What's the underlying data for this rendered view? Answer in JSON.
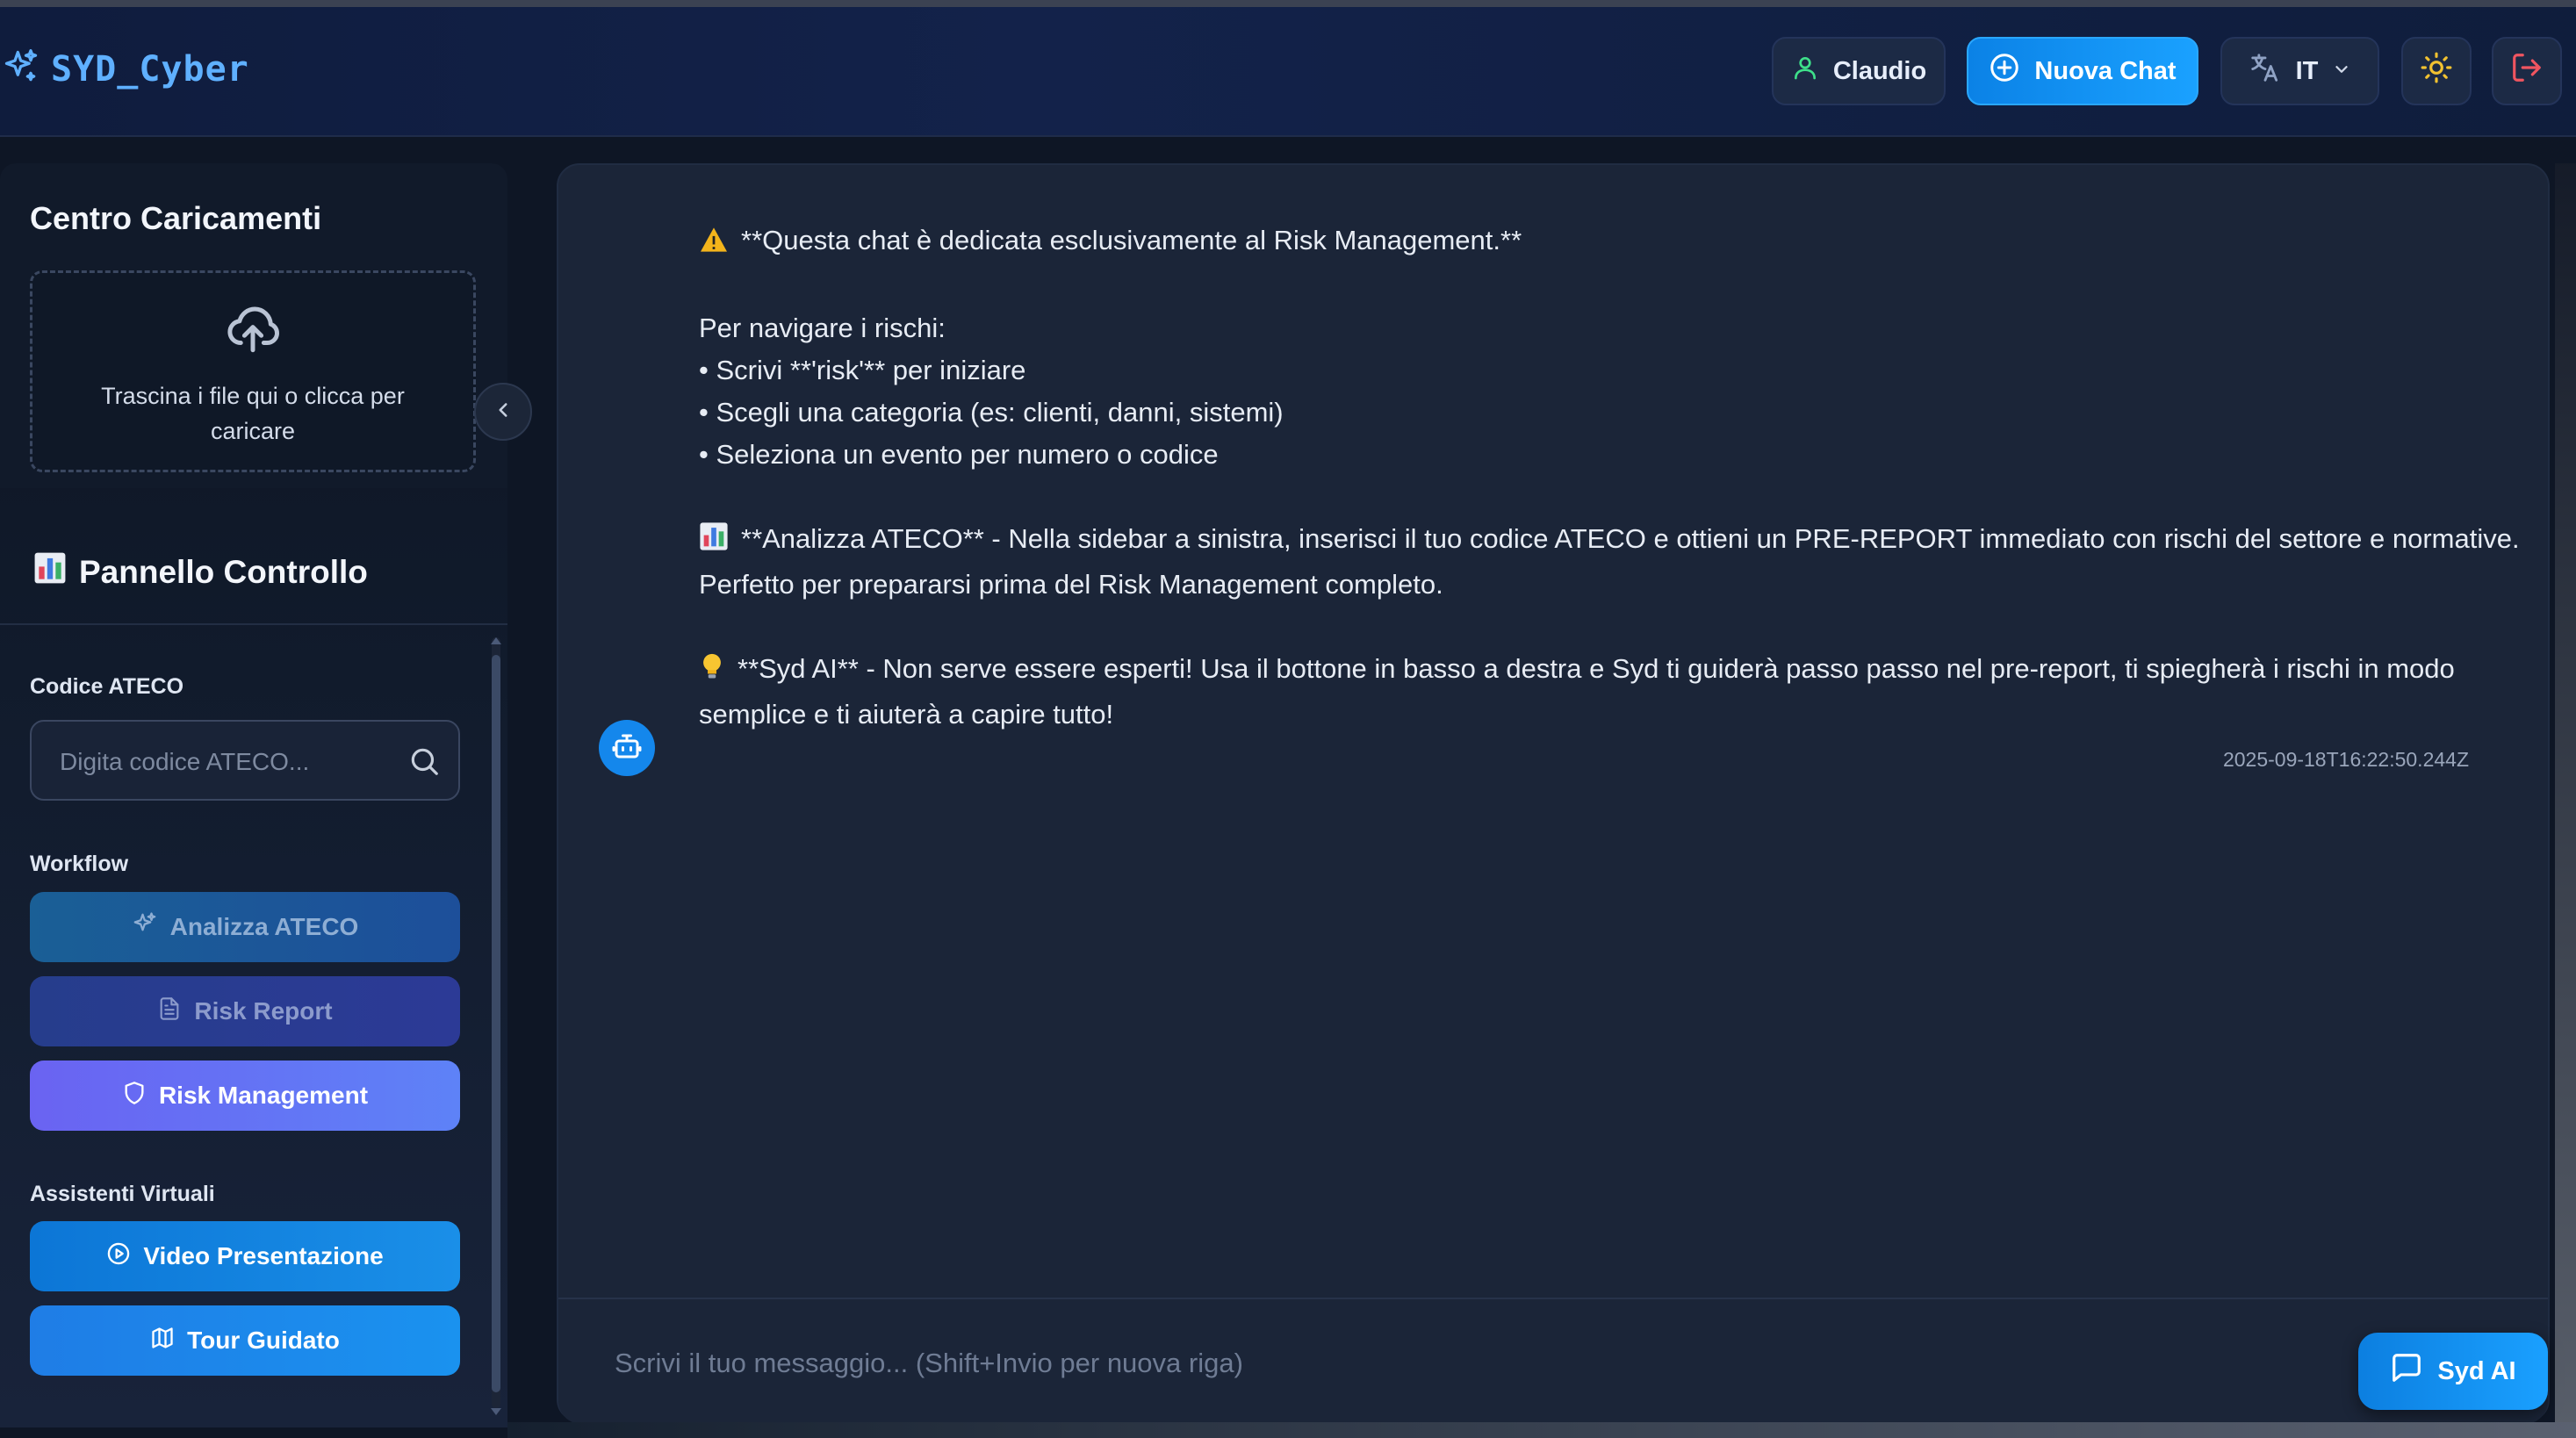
{
  "brand": {
    "name": "SYD_Cyber",
    "icon": "sparkle-icon",
    "color": "#5fb0ff"
  },
  "header": {
    "user_label": "Claudio",
    "new_chat_label": "Nuova Chat",
    "language_label": "IT",
    "icons": [
      "user-icon",
      "plus-circle-icon",
      "translate-icon",
      "chevron-down-icon",
      "sun-icon",
      "logout-icon"
    ]
  },
  "upload": {
    "title": "Centro Caricamenti",
    "dropzone_text": "Trascina i file qui o clicca per caricare",
    "icon": "cloud-upload-icon"
  },
  "control_panel": {
    "title": "Pannello Controllo",
    "ateco_label": "Codice ATECO",
    "ateco_placeholder": "Digita codice ATECO...",
    "ateco_value": "",
    "workflow_label": "Workflow",
    "workflow_buttons": [
      {
        "label": "Analizza ATECO",
        "icon": "sparkle-icon"
      },
      {
        "label": "Risk Report",
        "icon": "document-icon"
      },
      {
        "label": "Risk Management",
        "icon": "shield-icon"
      }
    ],
    "assistants_label": "Assistenti Virtuali",
    "assistant_buttons": [
      {
        "label": "Video Presentazione",
        "icon": "play-circle-icon"
      },
      {
        "label": "Tour Guidato",
        "icon": "map-icon"
      }
    ]
  },
  "chat": {
    "message": {
      "line1": "**Questa chat è dedicata esclusivamente al Risk Management.**",
      "line2": "Per navigare i rischi:",
      "line3": "• Scrivi **'risk'** per iniziare",
      "line4": "• Scegli una categoria (es: clienti, danni, sistemi)",
      "line5": "• Seleziona un evento per numero o codice",
      "line6": "**Analizza ATECO** - Nella sidebar a sinistra, inserisci il tuo codice ATECO e ottieni un PRE-REPORT immediato con rischi del settore e normative. Perfetto per prepararsi prima del Risk Management completo.",
      "line7": "**Syd AI** - Non serve essere esperti! Usa il bottone in basso a destra e Syd ti guiderà passo passo nel pre-report, ti spiegherà i rischi in modo semplice e ti aiuterà a capire tutto!",
      "timestamp": "2025-09-18T16:22:50.244Z"
    },
    "input_placeholder": "Scrivi il tuo messaggio... (Shift+Invio per nuova riga)",
    "input_value": "",
    "syd_button_label": "Syd AI"
  },
  "colors": {
    "accent": "#1a9bff",
    "risk_management": "#6a63f2",
    "background": "#0e1625",
    "panel": "#1b2538"
  }
}
